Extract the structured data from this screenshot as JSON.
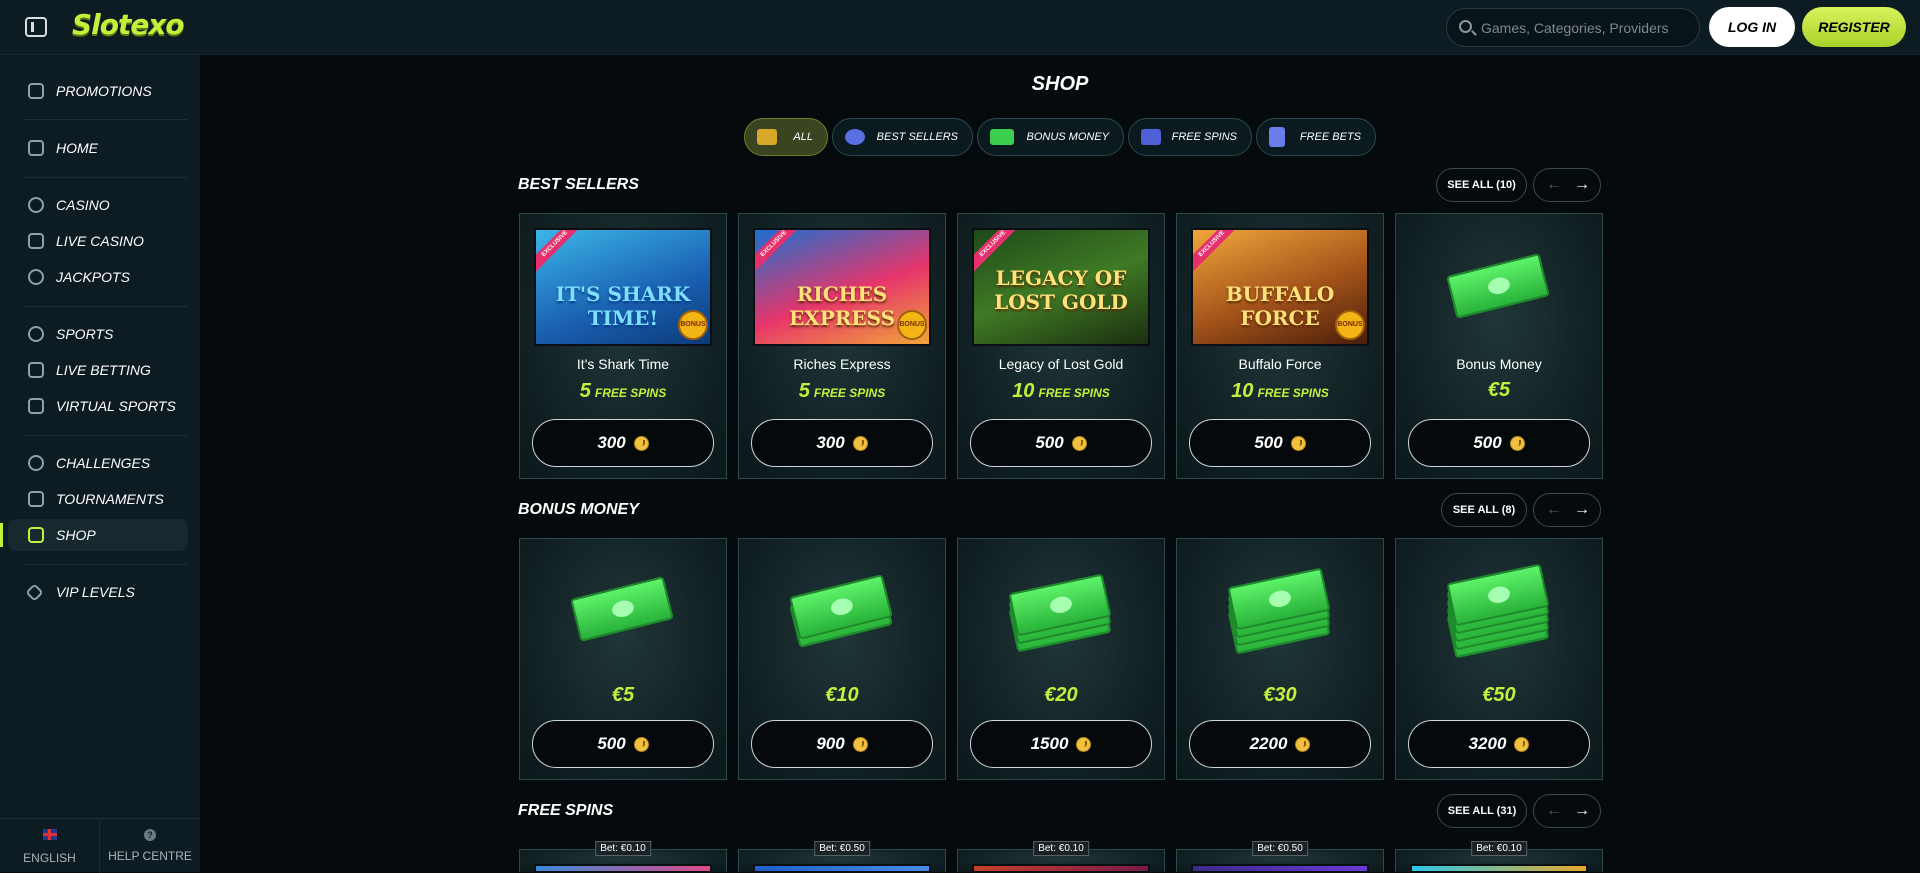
{
  "header": {
    "logo": "Slotexo",
    "search_placeholder": "Games, Categories, Providers",
    "login_label": "LOG IN",
    "register_label": "REGISTER"
  },
  "sidebar": {
    "items": [
      {
        "label": "PROMOTIONS",
        "icon": "gift-icon"
      },
      {
        "label": "HOME",
        "icon": "home-icon"
      },
      {
        "label": "CASINO",
        "icon": "chip-icon"
      },
      {
        "label": "LIVE CASINO",
        "icon": "spade-icon"
      },
      {
        "label": "JACKPOTS",
        "icon": "seven-icon"
      },
      {
        "label": "SPORTS",
        "icon": "soccer-ball-icon"
      },
      {
        "label": "LIVE BETTING",
        "icon": "play-icon"
      },
      {
        "label": "VIRTUAL SPORTS",
        "icon": "gamepad-icon"
      },
      {
        "label": "CHALLENGES",
        "icon": "target-icon"
      },
      {
        "label": "TOURNAMENTS",
        "icon": "trophy-icon"
      },
      {
        "label": "SHOP",
        "icon": "shop-icon",
        "active": true
      },
      {
        "label": "VIP LEVELS",
        "icon": "diamond-icon"
      }
    ],
    "footer": {
      "language": "ENGLISH",
      "help": "HELP CENTRE"
    }
  },
  "main": {
    "title": "SHOP",
    "filters": [
      {
        "label": "ALL",
        "active": true
      },
      {
        "label": "BEST SELLERS"
      },
      {
        "label": "BONUS MONEY"
      },
      {
        "label": "FREE SPINS"
      },
      {
        "label": "FREE BETS"
      }
    ],
    "sections": [
      {
        "title": "BEST SELLERS",
        "see_all": "SEE ALL (10)",
        "items": [
          {
            "thumb": "IT'S SHARK TIME!",
            "name": "It's Shark Time",
            "spins": "5",
            "unit": "FREE SPINS",
            "price": "300"
          },
          {
            "thumb": "RICHES EXPRESS",
            "name": "Riches Express",
            "spins": "5",
            "unit": "FREE SPINS",
            "price": "300"
          },
          {
            "thumb": "LEGACY OF LOST GOLD",
            "name": "Legacy of Lost Gold",
            "spins": "10",
            "unit": "FREE SPINS",
            "price": "500"
          },
          {
            "thumb": "BUFFALO FORCE",
            "name": "Buffalo Force",
            "spins": "10",
            "unit": "FREE SPINS",
            "price": "500"
          },
          {
            "name": "Bonus Money",
            "value": "€5",
            "price": "500"
          }
        ]
      },
      {
        "title": "BONUS MONEY",
        "see_all": "SEE ALL (8)",
        "items": [
          {
            "value": "€5",
            "price": "500"
          },
          {
            "value": "€10",
            "price": "900"
          },
          {
            "value": "€20",
            "price": "1500"
          },
          {
            "value": "€30",
            "price": "2200"
          },
          {
            "value": "€50",
            "price": "3200"
          }
        ]
      },
      {
        "title": "FREE SPINS",
        "see_all": "SEE ALL (31)",
        "items": [
          {
            "bet": "Bet: €0.10"
          },
          {
            "bet": "Bet: €0.50"
          },
          {
            "bet": "Bet: €0.10"
          },
          {
            "bet": "Bet: €0.50"
          },
          {
            "bet": "Bet: €0.10"
          }
        ]
      }
    ]
  },
  "colors": {
    "accent": "#c6ef3c",
    "background": "#050a0c",
    "sidebar": "#0d1b22"
  }
}
